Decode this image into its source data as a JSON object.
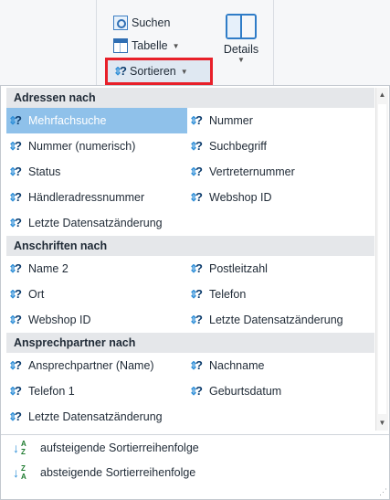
{
  "ribbon": {
    "search_label": "Suchen",
    "table_label": "Tabelle",
    "sort_label": "Sortieren",
    "details_label": "Details"
  },
  "groups": [
    {
      "header": "Adressen nach",
      "rows": [
        [
          "Mehrfachsuche",
          "Nummer"
        ],
        [
          "Nummer (numerisch)",
          "Suchbegriff"
        ],
        [
          "Status",
          "Vertreternummer"
        ],
        [
          "Händleradressnummer",
          "Webshop ID"
        ],
        [
          "Letzte Datensatzänderung"
        ]
      ]
    },
    {
      "header": "Anschriften nach",
      "rows": [
        [
          "Name 2",
          "Postleitzahl"
        ],
        [
          "Ort",
          "Telefon"
        ],
        [
          "Webshop ID",
          "Letzte Datensatzänderung"
        ]
      ]
    },
    {
      "header": "Ansprechpartner nach",
      "rows": [
        [
          "Ansprechpartner (Name)",
          "Nachname"
        ],
        [
          "Telefon 1",
          "Geburtsdatum"
        ],
        [
          "Letzte Datensatzänderung"
        ]
      ]
    }
  ],
  "selected_item": "Mehrfachsuche",
  "footer": {
    "ascending": "aufsteigende Sortierreihenfolge",
    "descending": "absteigende Sortierreihenfolge"
  },
  "colors": {
    "highlight": "#e8202a",
    "selection": "#8fc1ea",
    "accent": "#2f7cc7"
  }
}
